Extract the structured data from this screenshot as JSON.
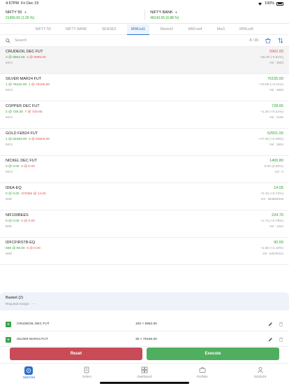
{
  "status_bar": {
    "time": "4:57PM",
    "date": "Fri Dec 15",
    "battery": "100%"
  },
  "indices": [
    {
      "name": "NIFTY 50",
      "value": "21456.65",
      "change": "(1.26 %)"
    },
    {
      "name": "NIFTY BANK",
      "value": "48143.55",
      "change": "(0.88 %)"
    }
  ],
  "tabs": [
    "NIFTY 50",
    "NIFTY BANK",
    "SENSEX",
    "MWList1",
    "Market2",
    "MWList4",
    "Mw3",
    "MWList5"
  ],
  "active_tab": 3,
  "search": {
    "placeholder": "Search",
    "count": "8 / 30"
  },
  "rows": [
    {
      "symbol": "CRUDEOIL DEC FUT",
      "ltp": "5962.00",
      "bid": "3 @ 5964.00",
      "ask": "2 @ 5965.00",
      "change": "-55.00 (-0.91%)",
      "exchange": "MCX",
      "vol": "Vol : 3663",
      "dir": "down"
    },
    {
      "symbol": "SILVER MAR24 FUT",
      "ltp": "75155.00",
      "bid": "1 @ 75152.00",
      "ask": "1 @ 75165.00",
      "change": "+78.00 (+0.11%)",
      "exchange": "MCX",
      "vol": "Vol : 4802",
      "dir": "up"
    },
    {
      "symbol": "COPPER DEC FUT",
      "ltp": "728.65",
      "bid": "2 @ 728.35",
      "ask": "7 @ 728.65",
      "change": "+1.20 (+0.21%)",
      "exchange": "MCX",
      "vol": "Vol : 2182",
      "dir": "up"
    },
    {
      "symbol": "GOLD FEB24 FUT",
      "ltp": "62501.00",
      "bid": "1 @ 62493.00",
      "ask": "3 @ 62503.00",
      "change": "+47.00 (+0.08%)",
      "exchange": "MCX",
      "vol": "Vol : 1804",
      "dir": "up"
    },
    {
      "symbol": "NICKEL DEC FUT",
      "ltp": "1400.80",
      "bid": "0 @ 0.00",
      "ask": "0 @ 0.00",
      "change": "0.00 (0.00%)",
      "exchange": "MCX",
      "vol": "Vol : 0",
      "dir": "up"
    },
    {
      "symbol": "IDEA-EQ",
      "ltp": "14.05",
      "bid": "0 @ 0.00",
      "ask": "473392 @ 14.05",
      "change": "+0.10 (+0.72%)",
      "exchange": "NSE",
      "vol": "Vol : 394803519",
      "dir": "up"
    },
    {
      "symbol": "NIF100BEES",
      "ltp": "224.79",
      "bid": "0 @ 0.00",
      "ask": "0 @ 0.00",
      "change": "+1.74 (+0.78%)",
      "exchange": "BSE",
      "vol": "Vol : 1344",
      "dir": "up"
    },
    {
      "symbol": "IDFCFIRSTB-EQ",
      "ltp": "90.00",
      "bid": "666 @ 90.00",
      "ask": "0 @ 0.00",
      "change": "+1.85 (+2.10%)",
      "exchange": "NSE",
      "vol": "Vol : 52976414",
      "dir": "up"
    }
  ],
  "basket": {
    "title": "Basket (2)",
    "margin_label": "Required margin :",
    "margin_value": "---",
    "items": [
      {
        "tag": "B",
        "symbol": "CRUDEOIL DEC FUT",
        "qty": "100 × 5962.00"
      },
      {
        "tag": "B",
        "symbol": "SILVER MAR24 FUT",
        "qty": "30 × 75155.00"
      }
    ]
  },
  "buttons": {
    "reset": "Reset",
    "execute": "Execute"
  },
  "nav": [
    {
      "label": "Watchlist",
      "icon": "watchlist-icon"
    },
    {
      "label": "Orders",
      "icon": "orders-icon"
    },
    {
      "label": "Dashboard",
      "icon": "dashboard-icon"
    },
    {
      "label": "Portfolio",
      "icon": "portfolio-icon"
    },
    {
      "label": "DZ10219",
      "icon": "user-icon"
    }
  ],
  "colors": {
    "accent": "#2a6fc9",
    "up": "#2aa52a",
    "down": "#d9534f",
    "reset": "#c84b57",
    "execute": "#4fae5f"
  }
}
